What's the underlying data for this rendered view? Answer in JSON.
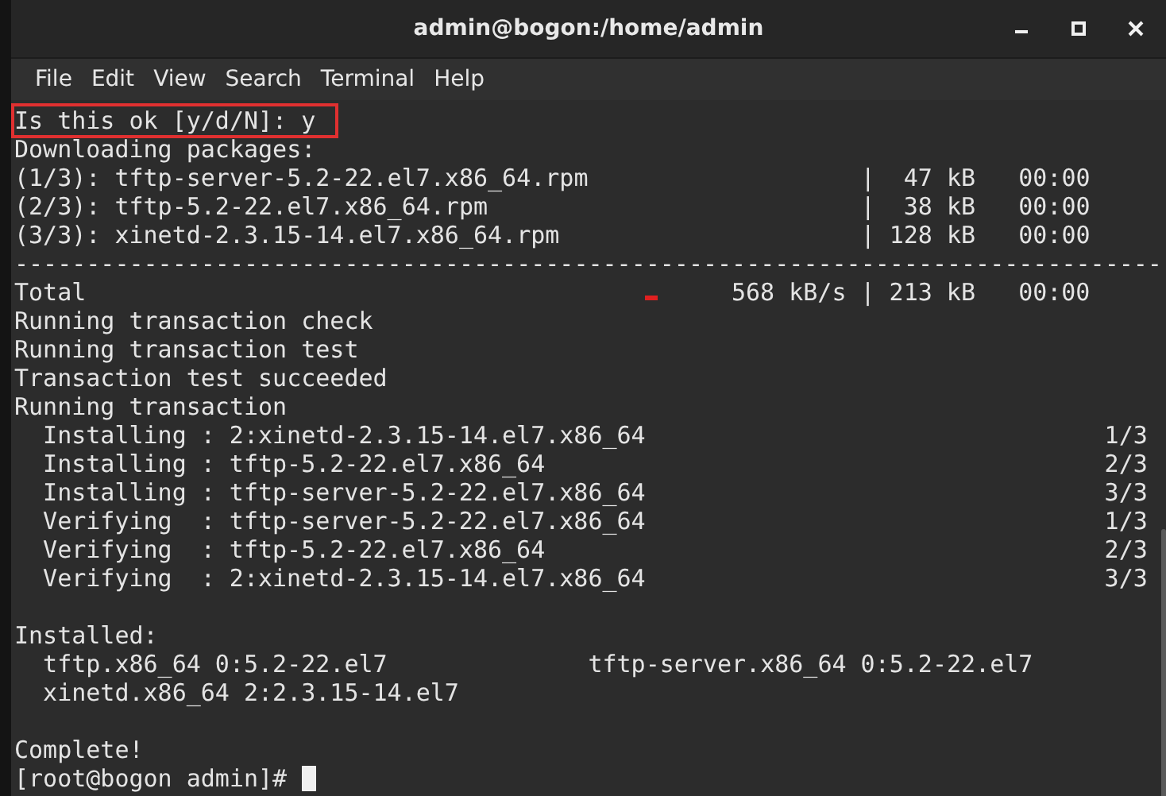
{
  "window": {
    "title": "admin@bogon:/home/admin"
  },
  "menu": [
    "File",
    "Edit",
    "View",
    "Search",
    "Terminal",
    "Help"
  ],
  "terminal": {
    "confirm": {
      "text": "Is this ok [y/d/N]: y",
      "highlighted": true
    },
    "downloading": "Downloading packages:",
    "downloads": [
      {
        "name": "(1/3): tftp-server-5.2-22.el7.x86_64.rpm",
        "separator": "|",
        "size": "47 kB",
        "time": "00:00"
      },
      {
        "name": "(2/3): tftp-5.2-22.el7.x86_64.rpm",
        "separator": "|",
        "size": "38 kB",
        "time": "00:00"
      },
      {
        "name": "(3/3): xinetd-2.3.15-14.el7.x86_64.rpm",
        "separator": "|",
        "size": "128 kB",
        "time": "00:00"
      }
    ],
    "rule": "--------------------------------------------------------------------------------",
    "total": {
      "label": "Total",
      "rate": "568 kB/s",
      "separator": "|",
      "size": "213 kB",
      "time": "00:00"
    },
    "messages": [
      "Running transaction check",
      "Running transaction test",
      "Transaction test succeeded",
      "Running transaction"
    ],
    "steps": [
      {
        "action": "Installing",
        "colon": ":",
        "package": "2:xinetd-2.3.15-14.el7.x86_64",
        "progress": "1/3"
      },
      {
        "action": "Installing",
        "colon": ":",
        "package": "tftp-5.2-22.el7.x86_64",
        "progress": "2/3"
      },
      {
        "action": "Installing",
        "colon": ":",
        "package": "tftp-server-5.2-22.el7.x86_64",
        "progress": "3/3"
      },
      {
        "action": "Verifying",
        "colon": ":",
        "package": "tftp-server-5.2-22.el7.x86_64",
        "progress": "1/3"
      },
      {
        "action": "Verifying",
        "colon": ":",
        "package": "tftp-5.2-22.el7.x86_64",
        "progress": "2/3"
      },
      {
        "action": "Verifying",
        "colon": ":",
        "package": "2:xinetd-2.3.15-14.el7.x86_64",
        "progress": "3/3"
      }
    ],
    "installed_header": "Installed:",
    "installed": [
      "tftp.x86_64 0:5.2-22.el7",
      "tftp-server.x86_64 0:5.2-22.el7",
      "xinetd.x86_64 2:2.3.15-14.el7"
    ],
    "complete": "Complete!",
    "prompt": "[root@bogon admin]#"
  }
}
